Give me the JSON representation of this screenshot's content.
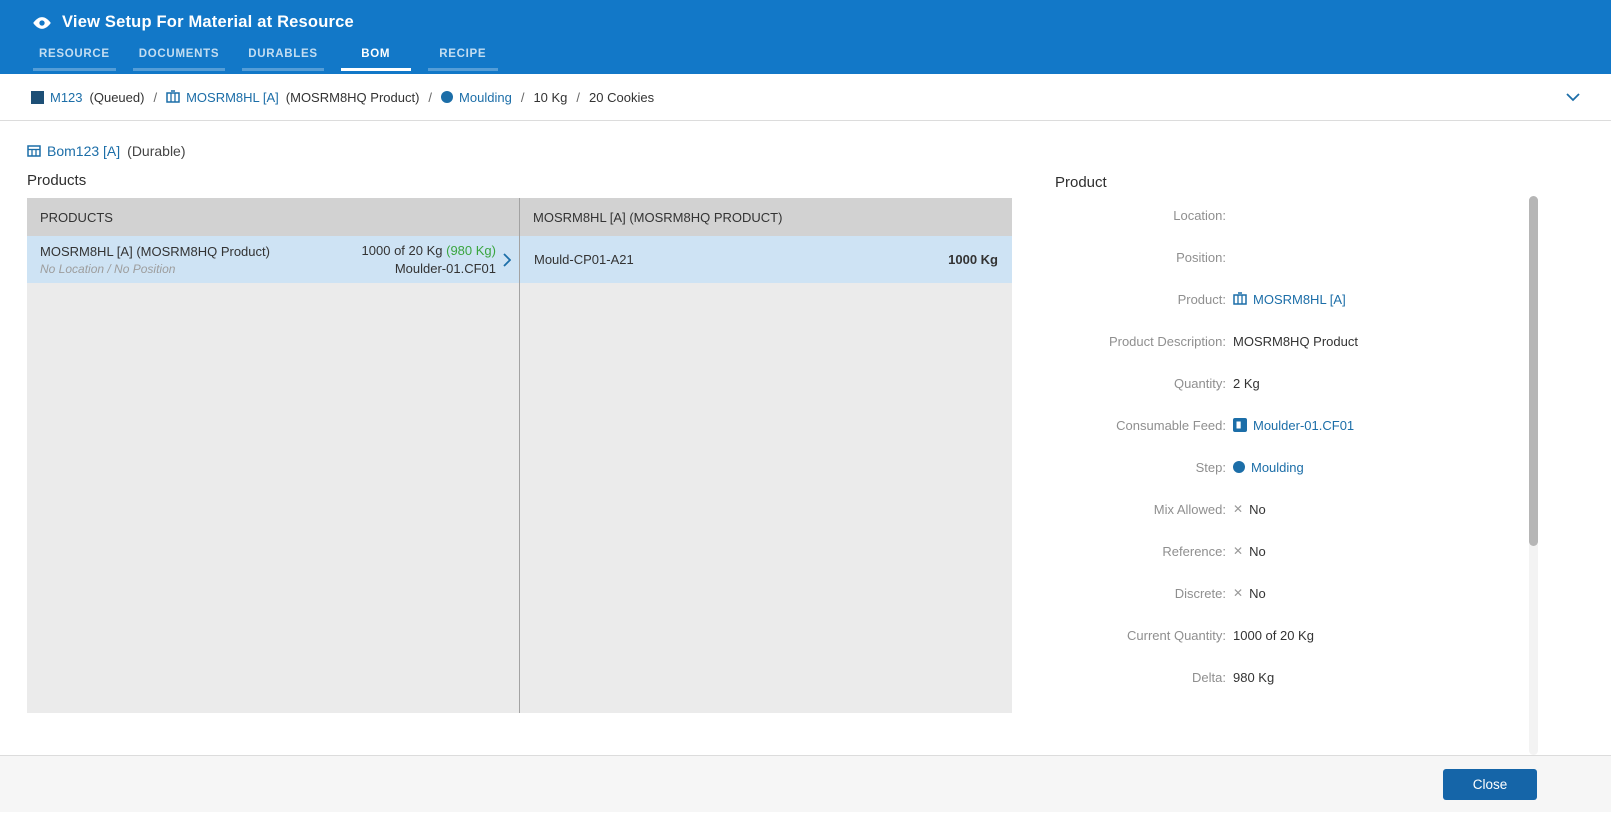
{
  "colors": {
    "header_bg": "#1278c8",
    "link_blue": "#1c6ea8",
    "success_green": "#3aa53f",
    "selected_row_bg": "#cee3f4",
    "table_header_bg": "#d2d2d2",
    "table_empty_bg": "#ebebeb",
    "close_button_bg": "#1565a8"
  },
  "icons": {
    "cross": "✕"
  },
  "header": {
    "title": "View Setup For Material at Resource",
    "active_tab": "BOM",
    "tabs": [
      {
        "label": "RESOURCE"
      },
      {
        "label": "DOCUMENTS"
      },
      {
        "label": "DURABLES"
      },
      {
        "label": "BOM"
      },
      {
        "label": "RECIPE"
      }
    ]
  },
  "breadcrumb": {
    "separator": "/",
    "material": {
      "name": "M123",
      "status": "(Queued)"
    },
    "product": {
      "name": "MOSRM8HL [A]",
      "description": "(MOSRM8HQ Product)"
    },
    "step": {
      "name": "Moulding"
    },
    "quantity": "10 Kg",
    "secondary_quantity": "20 Cookies"
  },
  "bom": {
    "name": "Bom123 [A]",
    "type": "(Durable)",
    "section_title": "Products"
  },
  "products_table": {
    "header": "PRODUCTS",
    "rows": [
      {
        "title": "MOSRM8HL [A] (MOSRM8HQ Product)",
        "subtitle": "No Location / No Position",
        "quantity": "1000 of 20 Kg",
        "delta": "(980 Kg)",
        "feed": "Moulder-01.CF01"
      }
    ]
  },
  "detail_table": {
    "header": "MOSRM8HL [A] (MOSRM8HQ PRODUCT)",
    "rows": [
      {
        "name": "Mould-CP01-A21",
        "quantity": "1000 Kg"
      }
    ]
  },
  "product_panel": {
    "title": "Product",
    "fields": [
      {
        "label": "Location:",
        "value": ""
      },
      {
        "label": "Position:",
        "value": ""
      },
      {
        "label": "Product:",
        "value": "MOSRM8HL [A]"
      },
      {
        "label": "Product Description:",
        "value": "MOSRM8HQ Product"
      },
      {
        "label": "Quantity:",
        "value": "2 Kg"
      },
      {
        "label": "Consumable Feed:",
        "value": "Moulder-01.CF01"
      },
      {
        "label": "Step:",
        "value": "Moulding"
      },
      {
        "label": "Mix Allowed:",
        "value": "No"
      },
      {
        "label": "Reference:",
        "value": "No"
      },
      {
        "label": "Discrete:",
        "value": "No"
      },
      {
        "label": "Current Quantity:",
        "value": "1000 of 20 Kg"
      },
      {
        "label": "Delta:",
        "value": "980 Kg"
      }
    ]
  },
  "footer": {
    "close_label": "Close"
  }
}
